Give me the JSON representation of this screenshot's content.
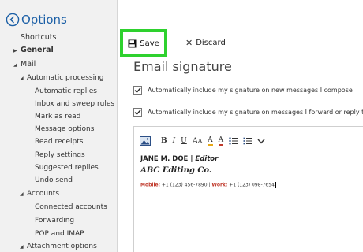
{
  "sidebar": {
    "title": "Options",
    "items": [
      {
        "label": "Shortcuts",
        "caret": ""
      },
      {
        "label": "General",
        "caret": "▶"
      },
      {
        "label": "Mail",
        "caret": "◢"
      },
      {
        "label": "Automatic processing",
        "caret": "◢"
      },
      {
        "label": "Automatic replies",
        "caret": ""
      },
      {
        "label": "Inbox and sweep rules",
        "caret": ""
      },
      {
        "label": "Mark as read",
        "caret": ""
      },
      {
        "label": "Message options",
        "caret": ""
      },
      {
        "label": "Read receipts",
        "caret": ""
      },
      {
        "label": "Reply settings",
        "caret": ""
      },
      {
        "label": "Suggested replies",
        "caret": ""
      },
      {
        "label": "Undo send",
        "caret": ""
      },
      {
        "label": "Accounts",
        "caret": "◢"
      },
      {
        "label": "Connected accounts",
        "caret": ""
      },
      {
        "label": "Forwarding",
        "caret": ""
      },
      {
        "label": "POP and IMAP",
        "caret": ""
      },
      {
        "label": "Attachment options",
        "caret": "◢"
      }
    ]
  },
  "toolbar": {
    "save_label": "Save",
    "discard_label": "Discard"
  },
  "main": {
    "section_title": "Email signature",
    "option_new": "Automatically include my signature on new messages I compose",
    "option_reply": "Automatically include my signature on messages I forward or reply to",
    "option_new_checked": true,
    "option_reply_checked": true
  },
  "editor": {
    "toolbar_labels": {
      "bold": "B",
      "italic": "I",
      "underline": "U",
      "font_size": "A",
      "font_size_small": "A",
      "highlight": "A",
      "font_color": "A"
    },
    "signature": {
      "name": "JANE M. DOE",
      "separator": " | ",
      "role": "Editor",
      "company": "ABC Editing Co.",
      "mobile_label": "Mobile:",
      "mobile": " +1 (123) 456-7890 | ",
      "work_label": "Work:",
      "work": " +1 (123) 098-7654"
    }
  },
  "colors": {
    "accent": "#1b5fa6",
    "save_highlight": "#2ed12e",
    "sidebar_bg": "#f1f1f1",
    "highlight_color": "#e6a817",
    "font_color": "#c0392b"
  }
}
